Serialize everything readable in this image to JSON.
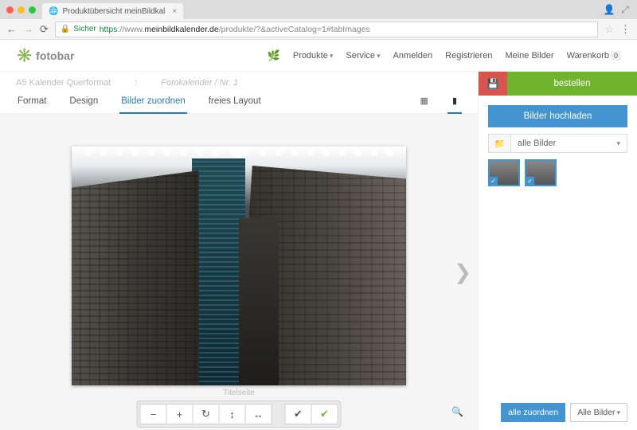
{
  "browser": {
    "tab_title": "Produktübersicht meinBildkal",
    "secure_label": "Sicher",
    "url_https": "https",
    "url_prefix": "://www.",
    "url_host": "meinbildkalender.de",
    "url_tail": "/produkte/?&activeCatalog=1#tabImages"
  },
  "header": {
    "logo_text": "fotobar",
    "menu": {
      "produkte": "Produkte",
      "service": "Service"
    },
    "anmelden": "Anmelden",
    "registrieren": "Registrieren",
    "meine_bilder": "Meine Bilder",
    "warenkorb": "Warenkorb",
    "cart_count": "0"
  },
  "breadcrumb": {
    "a": "A5 Kalender Querformat",
    "sep": ":",
    "b": "Fotokalender / Nr. 1"
  },
  "tabs": {
    "format": "Format",
    "design": "Design",
    "assign": "Bilder zuordnen",
    "free": "freies Layout"
  },
  "editor": {
    "subtitle": "Titelseite"
  },
  "order": {
    "bestellen": "bestellen"
  },
  "sidebar": {
    "upload": "Bilder hochladen",
    "folder_sel": "alle Bilder",
    "alle_zuordnen": "alle zuordnen",
    "alle_bilder_btn": "Alle Bilder"
  }
}
